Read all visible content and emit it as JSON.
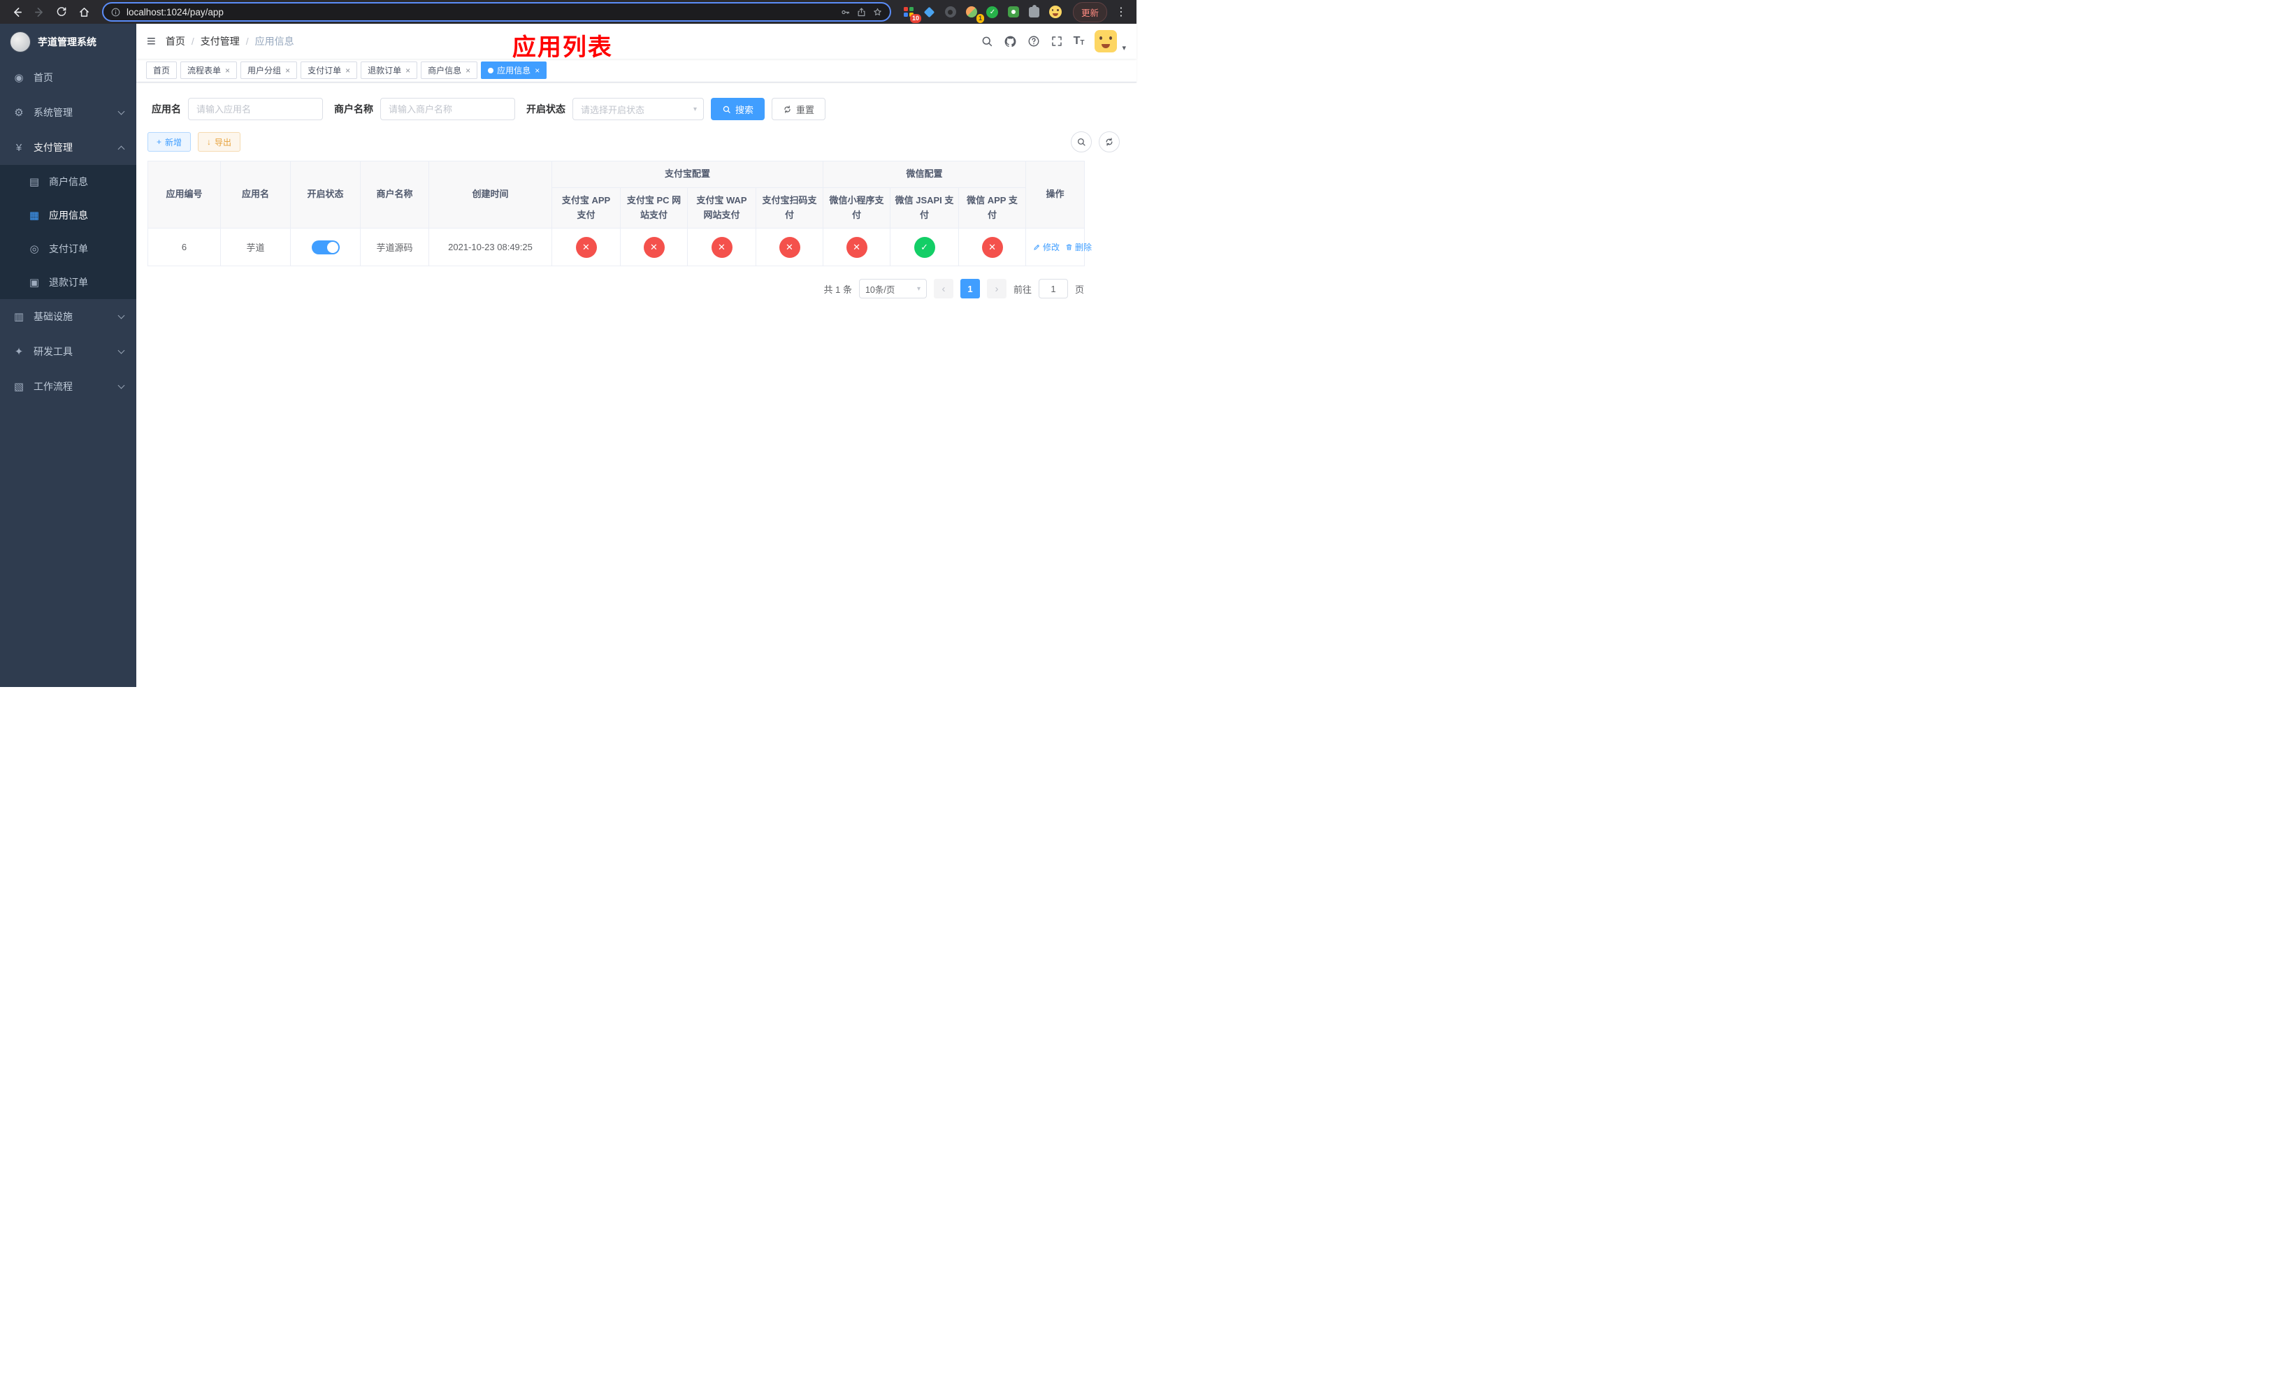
{
  "colors": {
    "accent": "#409eff",
    "danger": "#f4514c",
    "success": "#13ce66",
    "warning": "#e6a23c",
    "annotation": "#ff0000",
    "sidebar_bg": "#2f3c4f",
    "submenu_bg": "#1f2d3d"
  },
  "glyphs": {
    "check": "✓",
    "cross": "✕",
    "close": "×",
    "hamburger": "≡",
    "caret": "▾",
    "more": "⋮",
    "prev": "‹",
    "next": "›",
    "plus": "+",
    "download": "↓",
    "dashboard": "◉",
    "gear": "⚙",
    "yen": "¥",
    "merchant": "▤",
    "app": "▦",
    "order": "◎",
    "refund": "▣",
    "infra": "▥",
    "tools": "✦",
    "workflow": "▧"
  },
  "browser": {
    "url": "localhost:1024/pay/app",
    "update_label": "更新",
    "badges": {
      "extensions": "10",
      "profile": "1"
    }
  },
  "sidebar": {
    "title": "芋道管理系统",
    "items": [
      {
        "label": "首页"
      },
      {
        "label": "系统管理"
      },
      {
        "label": "支付管理"
      },
      {
        "label": "商户信息"
      },
      {
        "label": "应用信息"
      },
      {
        "label": "支付订单"
      },
      {
        "label": "退款订单"
      },
      {
        "label": "基础设施"
      },
      {
        "label": "研发工具"
      },
      {
        "label": "工作流程"
      }
    ]
  },
  "header": {
    "breadcrumb": [
      "首页",
      "支付管理",
      "应用信息"
    ],
    "annotation": "应用列表"
  },
  "tabs": [
    {
      "label": "首页"
    },
    {
      "label": "流程表单"
    },
    {
      "label": "用户分组"
    },
    {
      "label": "支付订单"
    },
    {
      "label": "退款订单"
    },
    {
      "label": "商户信息"
    },
    {
      "label": "应用信息"
    }
  ],
  "filters": {
    "app_name_label": "应用名",
    "app_name_placeholder": "请输入应用名",
    "merchant_label": "商户名称",
    "merchant_placeholder": "请输入商户名称",
    "status_label": "开启状态",
    "status_placeholder": "请选择开启状态",
    "search_label": "搜索",
    "reset_label": "重置"
  },
  "toolbar": {
    "add_label": "新增",
    "export_label": "导出"
  },
  "table": {
    "group_headers": {
      "alipay": "支付宝配置",
      "wechat": "微信配置"
    },
    "columns": {
      "id": "应用编号",
      "name": "应用名",
      "status": "开启状态",
      "merchant": "商户名称",
      "created": "创建时间",
      "alipay_app": "支付宝 APP 支付",
      "alipay_pc": "支付宝 PC 网站支付",
      "alipay_wap": "支付宝 WAP 网站支付",
      "alipay_qr": "支付宝扫码支付",
      "wx_mini": "微信小程序支付",
      "wx_jsapi": "微信 JSAPI 支付",
      "wx_app": "微信 APP 支付",
      "ops": "操作"
    },
    "row": {
      "id": "6",
      "name": "芋道",
      "enabled": true,
      "merchant": "芋道源码",
      "created": "2021-10-23 08:49:25",
      "pay_statuses": [
        false,
        false,
        false,
        false,
        false,
        true,
        false
      ],
      "edit_label": "修改",
      "delete_label": "删除"
    }
  },
  "pagination": {
    "total_label": "共 1 条",
    "page_size": "10条/页",
    "current_page": "1",
    "goto_label": "前往",
    "goto_value": "1",
    "page_suffix": "页"
  }
}
